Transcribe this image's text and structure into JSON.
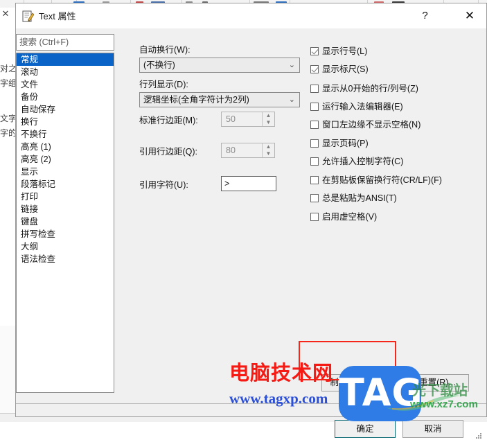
{
  "background": {
    "close_icon": "✕",
    "fragments": [
      "对之",
      "字组",
      "文字",
      "字的"
    ]
  },
  "dialog": {
    "title": "Text 属性",
    "title_icon": "notepad-pencil-icon",
    "help_label": "?",
    "close_label": "✕"
  },
  "search": {
    "placeholder": "搜索 (Ctrl+F)",
    "value": ""
  },
  "categories": {
    "selected_index": 0,
    "items": [
      "常规",
      "滚动",
      "文件",
      "备份",
      "自动保存",
      "换行",
      "不换行",
      "高亮 (1)",
      "高亮 (2)",
      "显示",
      "段落标记",
      "打印",
      "链接",
      "键盘",
      "拼写检查",
      "大纲",
      "语法检查"
    ]
  },
  "fields": {
    "wrap_label": "自动换行(W):",
    "wrap_value": "(不换行)",
    "colmode_label": "行列显示(D):",
    "colmode_value": "逻辑坐标(全角字符计为2列)",
    "std_margin_label": "标准行边距(M):",
    "std_margin_value": "50",
    "quote_margin_label": "引用行边距(Q):",
    "quote_margin_value": "80",
    "quote_char_label": "引用字符(U):",
    "quote_char_value": ">",
    "chevron": "⌄",
    "spin_up": "▲",
    "spin_down": "▼"
  },
  "checkboxes": [
    {
      "label": "显示行号(L)",
      "checked": true
    },
    {
      "label": "显示标尺(S)",
      "checked": true
    },
    {
      "label": "显示从0开始的行/列号(Z)",
      "checked": false
    },
    {
      "label": "运行输入法编辑器(E)",
      "checked": false
    },
    {
      "label": "窗口左边缘不显示空格(N)",
      "checked": false
    },
    {
      "label": "显示页码(P)",
      "checked": false
    },
    {
      "label": "允许插入控制字符(C)",
      "checked": false
    },
    {
      "label": "在剪贴板保留换行符(CR/LF)(F)",
      "checked": false
    },
    {
      "label": "总是粘贴为ANSI(T)",
      "checked": false
    },
    {
      "label": "启用虚空格(V)",
      "checked": false
    }
  ],
  "buttons": {
    "tab_indent": "制表符/缩进(I)...",
    "reset": "重置(R)...",
    "ok": "确定",
    "cancel": "取消"
  },
  "annotation": {
    "color": "#f5271a",
    "target": "tab-indent-button"
  },
  "watermarks": {
    "red_text": "电脑技术网",
    "red_color": "#f51b14",
    "blue_text": "www.tagxp.com",
    "blue_color": "#2b4fd6",
    "tag_text": "TAG",
    "tag_color": "#2f7ce6",
    "site_text": "光下载站",
    "site_url": "www.xz7.com",
    "site_color": "#2b8a3e"
  }
}
